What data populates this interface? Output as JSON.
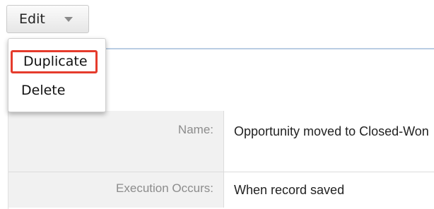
{
  "toolbar": {
    "edit_label": "Edit"
  },
  "dropdown": {
    "items": [
      {
        "label": "Duplicate",
        "highlighted": true
      },
      {
        "label": "Delete",
        "highlighted": false
      }
    ]
  },
  "record": {
    "fields": [
      {
        "label": "Name:",
        "value": "Opportunity moved to Closed-Won"
      },
      {
        "label": "Execution Occurs:",
        "value": "When record saved"
      }
    ]
  },
  "colors": {
    "highlight_border": "#e53b2c",
    "label_text": "#8c8c8c",
    "label_background": "#f1f1f1",
    "panel_top_border": "#b9cde3"
  },
  "icons": {
    "edit_caret": "chevron-down-icon"
  }
}
